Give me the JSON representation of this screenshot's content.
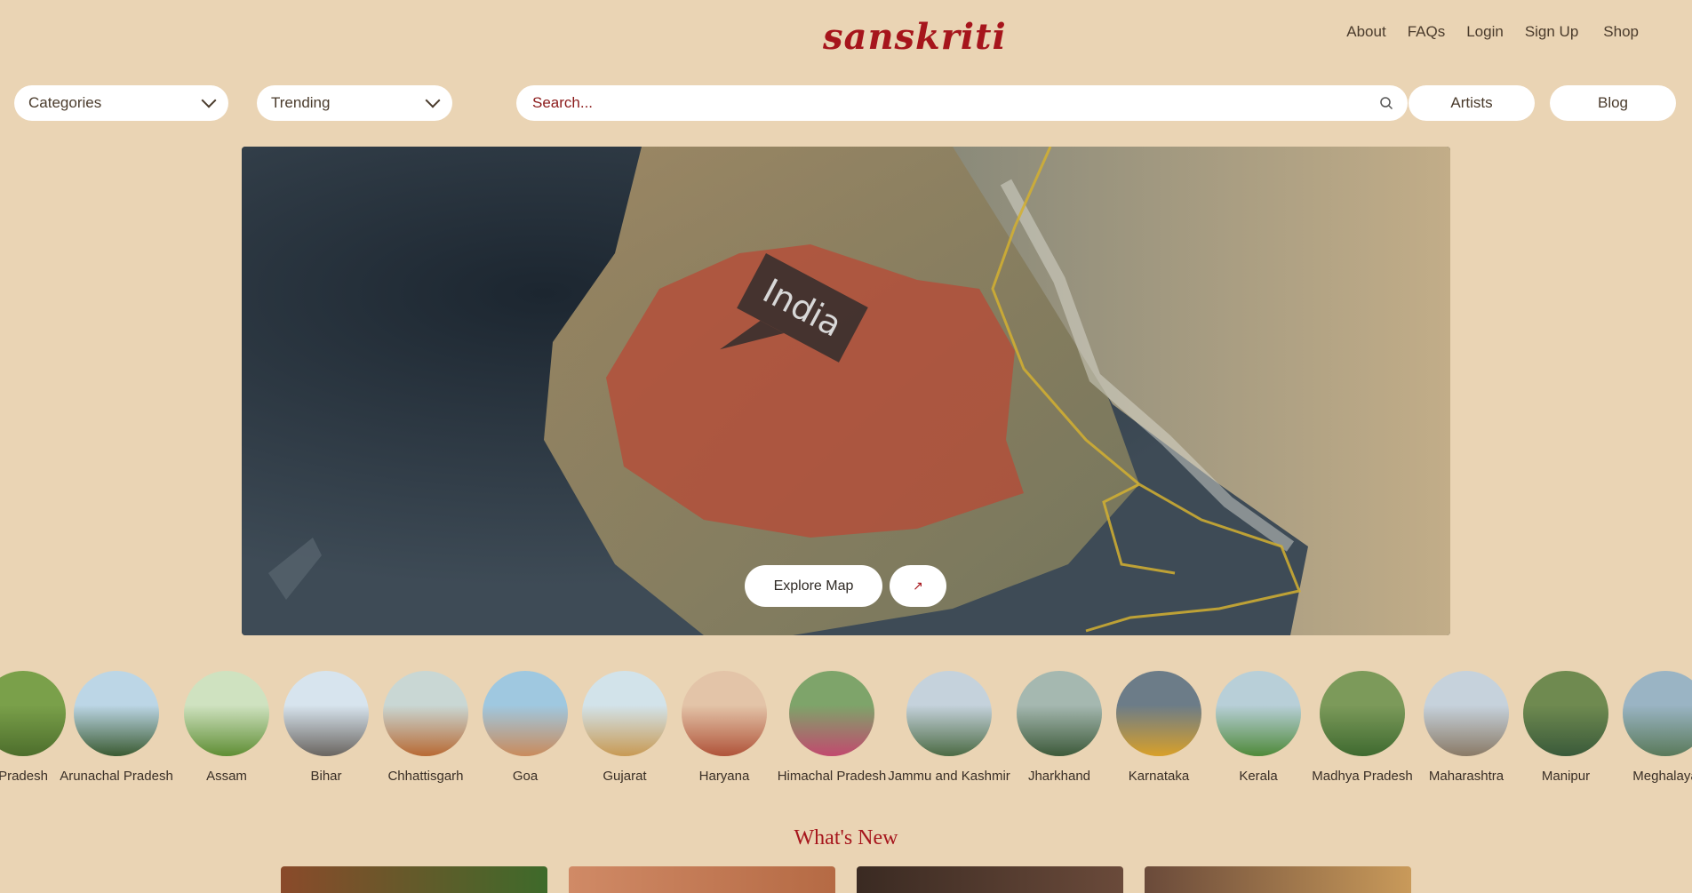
{
  "header": {
    "logo": "sanskriti",
    "nav": [
      "About",
      "FAQs",
      "Login",
      "Sign Up",
      "Shop"
    ]
  },
  "toolbar": {
    "categories": "Categories",
    "trending": "Trending",
    "search_placeholder": "Search...",
    "artists": "Artists",
    "blog": "Blog"
  },
  "hero": {
    "map_label": "India",
    "explore_label": "Explore Map",
    "arrow_icon": "arrow-up-right-icon"
  },
  "states": [
    {
      "label": "Pradesh",
      "colors": [
        "#7aa04a",
        "#4d6e2c"
      ]
    },
    {
      "label": "Arunachal Pradesh",
      "colors": [
        "#bcd6e6",
        "#3b5b32"
      ]
    },
    {
      "label": "Assam",
      "colors": [
        "#cfe2c0",
        "#5f8e34"
      ]
    },
    {
      "label": "Bihar",
      "colors": [
        "#d7e4ee",
        "#6a6560"
      ]
    },
    {
      "label": "Chhattisgarh",
      "colors": [
        "#c9d7d4",
        "#b86a34"
      ]
    },
    {
      "label": "Goa",
      "colors": [
        "#9fc8e0",
        "#c98b5c"
      ]
    },
    {
      "label": "Gujarat",
      "colors": [
        "#d2e3ea",
        "#c89a54"
      ]
    },
    {
      "label": "Haryana",
      "colors": [
        "#e3c4a8",
        "#b0543a"
      ]
    },
    {
      "label": "Himachal Pradesh",
      "colors": [
        "#7ea46a",
        "#c14a6e"
      ]
    },
    {
      "label": "Jammu and Kashmir",
      "colors": [
        "#c5d2dc",
        "#4c6b44"
      ]
    },
    {
      "label": "Jharkhand",
      "colors": [
        "#a5b8b0",
        "#3d5a3a"
      ]
    },
    {
      "label": "Karnataka",
      "colors": [
        "#6c7c88",
        "#d8a02a"
      ]
    },
    {
      "label": "Kerala",
      "colors": [
        "#b8cfd8",
        "#4f8a3a"
      ]
    },
    {
      "label": "Madhya Pradesh",
      "colors": [
        "#7c9a5a",
        "#3f6a30"
      ]
    },
    {
      "label": "Maharashtra",
      "colors": [
        "#c6d2dc",
        "#8a7a66"
      ]
    },
    {
      "label": "Manipur",
      "colors": [
        "#6f8a50",
        "#3a5a3a"
      ]
    },
    {
      "label": "Meghalaya",
      "colors": [
        "#9ab4c4",
        "#5a7a5a"
      ]
    }
  ],
  "whats_new": {
    "title": "What's New",
    "cards": [
      {
        "colors": [
          "#8a4a2a",
          "#3e6a2a"
        ]
      },
      {
        "colors": [
          "#d08a66",
          "#b56a44"
        ]
      },
      {
        "colors": [
          "#3a2a22",
          "#6a4a3a"
        ]
      },
      {
        "colors": [
          "#6a4a3a",
          "#c99a5a"
        ]
      }
    ]
  },
  "colors": {
    "background": "#ead4b4",
    "accent": "#a6151c",
    "highlight_region": "#b84a36",
    "border_line": "#d4b030"
  }
}
